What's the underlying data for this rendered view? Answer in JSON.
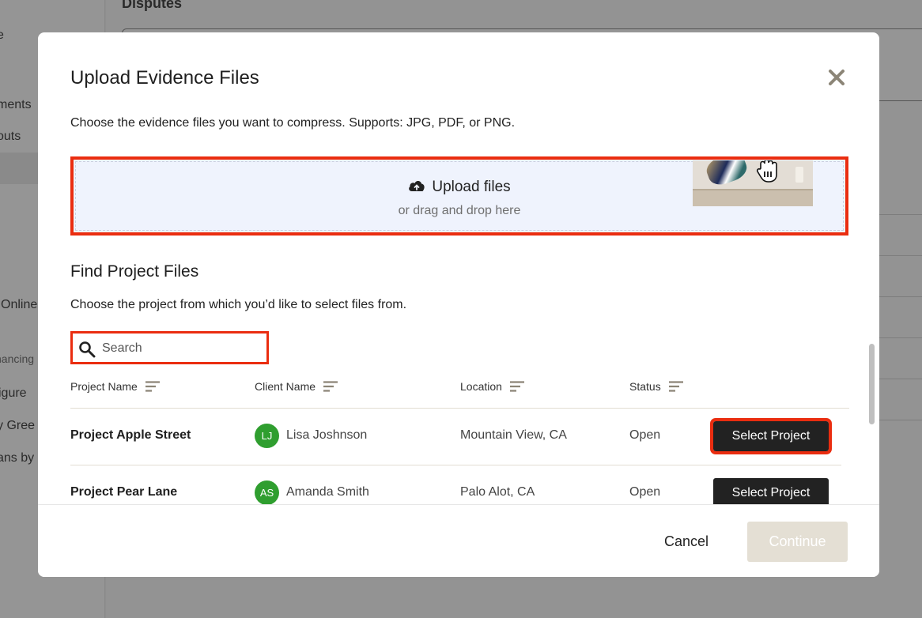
{
  "background": {
    "title": "Disputes",
    "sidebar": [
      "e",
      "ments",
      "outs",
      "Online",
      "nancing",
      "igure",
      "y Gree",
      "ans by"
    ]
  },
  "modal": {
    "title": "Upload Evidence Files",
    "description": "Choose the evidence files you want to compress. Supports: JPG, PDF, or PNG.",
    "dropzone": {
      "label": "Upload files",
      "sublabel": "or drag and drop here"
    },
    "section_title": "Find Project Files",
    "section_description": "Choose the project from which you’d like to select files from.",
    "search": {
      "placeholder": "Search",
      "value": ""
    },
    "columns": [
      "Project Name",
      "Client Name",
      "Location",
      "Status"
    ],
    "rows": [
      {
        "project": "Project Apple Street",
        "initials": "LJ",
        "client": "Lisa Joshnson",
        "location": "Mountain View, CA",
        "status": "Open",
        "action": "Select Project"
      },
      {
        "project": "Project Pear Lane",
        "initials": "AS",
        "client": "Amanda Smith",
        "location": "Palo Alot, CA",
        "status": "Open",
        "action": "Select Project"
      }
    ],
    "footer": {
      "cancel": "Cancel",
      "continue": "Continue"
    }
  },
  "colors": {
    "highlight": "#ea2d10",
    "avatar": "#2f9e2f",
    "button": "#222222",
    "disabled": "#e4dfd4"
  }
}
